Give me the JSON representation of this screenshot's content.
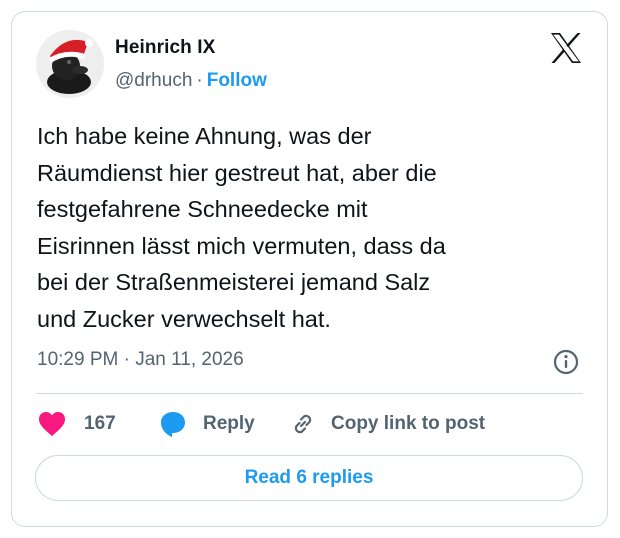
{
  "author": {
    "display_name": "Heinrich IX",
    "handle": "@drhuch",
    "separator": "·",
    "follow_label": "Follow",
    "avatar_icon": "rubber-duck-santa-hat-avatar"
  },
  "brand": {
    "icon": "x-logo-icon"
  },
  "post": {
    "text": "Ich habe keine Ahnung, was der\nRäumdienst hier gestreut hat, aber die\nfestgefahrene Schneedecke mit\nEisrinnen lässt mich vermuten, dass da\nbei der Straßenmeisterei jemand Salz\nund Zucker verwechselt hat.",
    "timestamp": "10:29 PM · Jan 11, 2026"
  },
  "actions": {
    "likes_count": "167",
    "reply_label": "Reply",
    "copy_label": "Copy link to post"
  },
  "footer": {
    "read_replies_label": "Read 6 replies"
  },
  "colors": {
    "accent": "#1d9bf0",
    "heart": "#f91880",
    "muted_text": "#536471",
    "border": "#cfd9de"
  }
}
